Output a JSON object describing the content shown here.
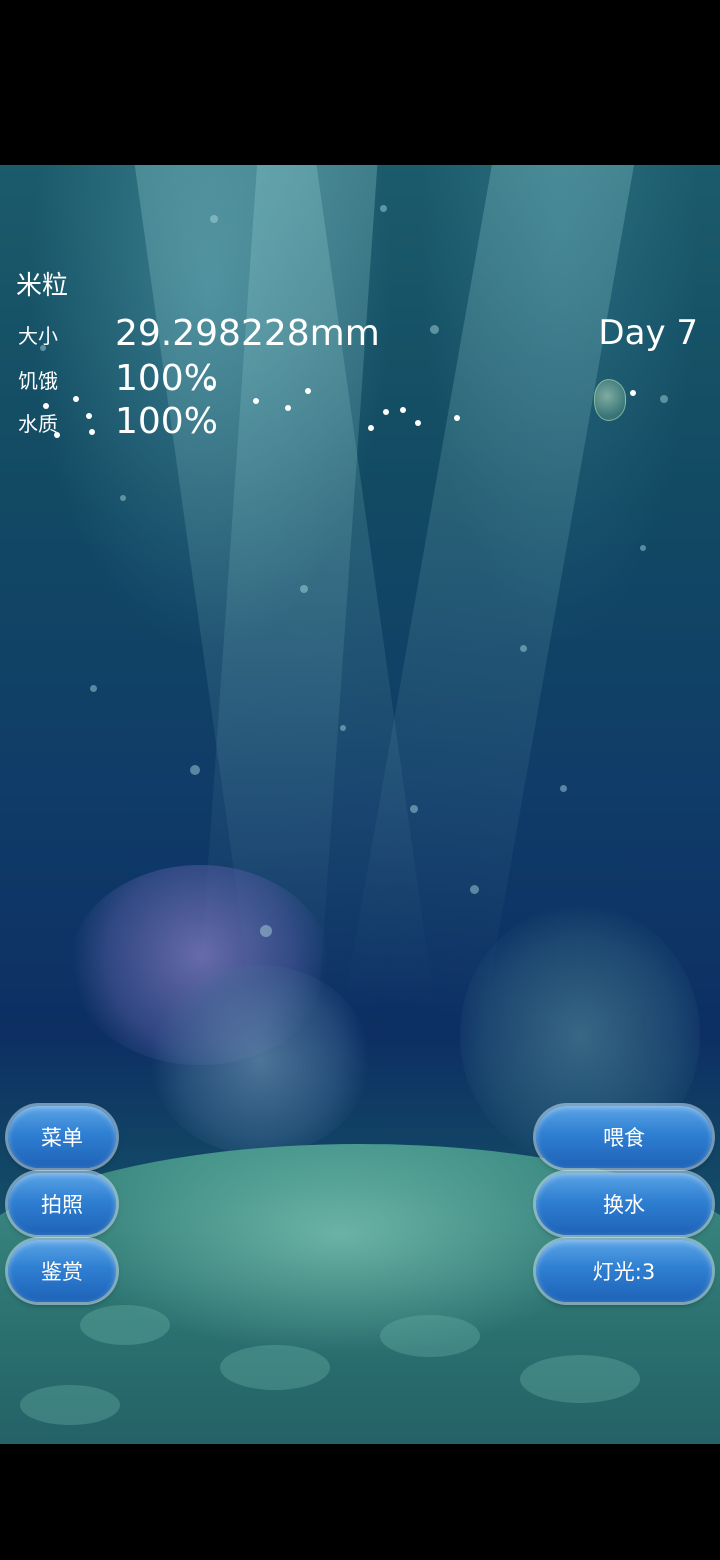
{
  "hud": {
    "pet_name": "米粒",
    "stats": [
      {
        "label": "大小",
        "value": "29.298228mm"
      },
      {
        "label": "饥饿",
        "value": "100%"
      },
      {
        "label": "水质",
        "value": "100%"
      }
    ],
    "day": "Day 7"
  },
  "left_menu": {
    "menu": "菜单",
    "photo": "拍照",
    "gallery": "鉴赏"
  },
  "right_menu": {
    "feed": "喂食",
    "change_water": "换水",
    "light": "灯光:3"
  },
  "colors": {
    "button_top": "#5aa4e6",
    "button_bottom": "#1e63b8",
    "water_deep": "#0d2f63",
    "water_light": "#1b5b6b"
  },
  "icons": {
    "jellyfish": "jellyfish-sprite",
    "food": "food-pellet"
  }
}
